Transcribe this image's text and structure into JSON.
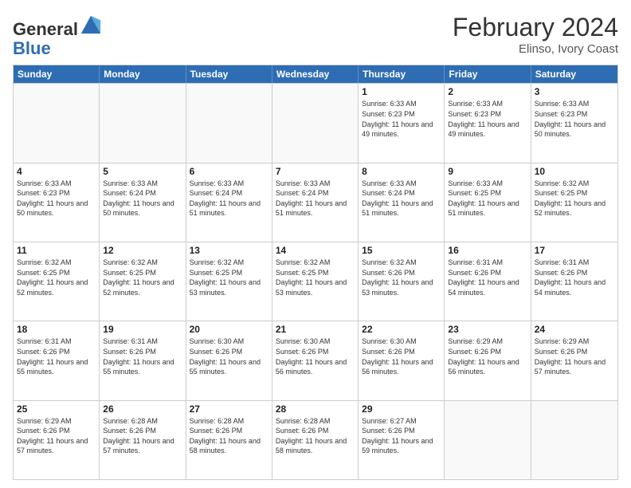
{
  "header": {
    "logo_line1": "General",
    "logo_line2": "Blue",
    "title": "February 2024",
    "subtitle": "Elinso, Ivory Coast"
  },
  "days_of_week": [
    "Sunday",
    "Monday",
    "Tuesday",
    "Wednesday",
    "Thursday",
    "Friday",
    "Saturday"
  ],
  "weeks": [
    [
      {
        "day": "",
        "info": "",
        "empty": true
      },
      {
        "day": "",
        "info": "",
        "empty": true
      },
      {
        "day": "",
        "info": "",
        "empty": true
      },
      {
        "day": "",
        "info": "",
        "empty": true
      },
      {
        "day": "1",
        "info": "Sunrise: 6:33 AM\nSunset: 6:23 PM\nDaylight: 11 hours\nand 49 minutes."
      },
      {
        "day": "2",
        "info": "Sunrise: 6:33 AM\nSunset: 6:23 PM\nDaylight: 11 hours\nand 49 minutes."
      },
      {
        "day": "3",
        "info": "Sunrise: 6:33 AM\nSunset: 6:23 PM\nDaylight: 11 hours\nand 50 minutes."
      }
    ],
    [
      {
        "day": "4",
        "info": "Sunrise: 6:33 AM\nSunset: 6:23 PM\nDaylight: 11 hours\nand 50 minutes."
      },
      {
        "day": "5",
        "info": "Sunrise: 6:33 AM\nSunset: 6:24 PM\nDaylight: 11 hours\nand 50 minutes."
      },
      {
        "day": "6",
        "info": "Sunrise: 6:33 AM\nSunset: 6:24 PM\nDaylight: 11 hours\nand 51 minutes."
      },
      {
        "day": "7",
        "info": "Sunrise: 6:33 AM\nSunset: 6:24 PM\nDaylight: 11 hours\nand 51 minutes."
      },
      {
        "day": "8",
        "info": "Sunrise: 6:33 AM\nSunset: 6:24 PM\nDaylight: 11 hours\nand 51 minutes."
      },
      {
        "day": "9",
        "info": "Sunrise: 6:33 AM\nSunset: 6:25 PM\nDaylight: 11 hours\nand 51 minutes."
      },
      {
        "day": "10",
        "info": "Sunrise: 6:32 AM\nSunset: 6:25 PM\nDaylight: 11 hours\nand 52 minutes."
      }
    ],
    [
      {
        "day": "11",
        "info": "Sunrise: 6:32 AM\nSunset: 6:25 PM\nDaylight: 11 hours\nand 52 minutes."
      },
      {
        "day": "12",
        "info": "Sunrise: 6:32 AM\nSunset: 6:25 PM\nDaylight: 11 hours\nand 52 minutes."
      },
      {
        "day": "13",
        "info": "Sunrise: 6:32 AM\nSunset: 6:25 PM\nDaylight: 11 hours\nand 53 minutes."
      },
      {
        "day": "14",
        "info": "Sunrise: 6:32 AM\nSunset: 6:25 PM\nDaylight: 11 hours\nand 53 minutes."
      },
      {
        "day": "15",
        "info": "Sunrise: 6:32 AM\nSunset: 6:26 PM\nDaylight: 11 hours\nand 53 minutes."
      },
      {
        "day": "16",
        "info": "Sunrise: 6:31 AM\nSunset: 6:26 PM\nDaylight: 11 hours\nand 54 minutes."
      },
      {
        "day": "17",
        "info": "Sunrise: 6:31 AM\nSunset: 6:26 PM\nDaylight: 11 hours\nand 54 minutes."
      }
    ],
    [
      {
        "day": "18",
        "info": "Sunrise: 6:31 AM\nSunset: 6:26 PM\nDaylight: 11 hours\nand 55 minutes."
      },
      {
        "day": "19",
        "info": "Sunrise: 6:31 AM\nSunset: 6:26 PM\nDaylight: 11 hours\nand 55 minutes."
      },
      {
        "day": "20",
        "info": "Sunrise: 6:30 AM\nSunset: 6:26 PM\nDaylight: 11 hours\nand 55 minutes."
      },
      {
        "day": "21",
        "info": "Sunrise: 6:30 AM\nSunset: 6:26 PM\nDaylight: 11 hours\nand 56 minutes."
      },
      {
        "day": "22",
        "info": "Sunrise: 6:30 AM\nSunset: 6:26 PM\nDaylight: 11 hours\nand 56 minutes."
      },
      {
        "day": "23",
        "info": "Sunrise: 6:29 AM\nSunset: 6:26 PM\nDaylight: 11 hours\nand 56 minutes."
      },
      {
        "day": "24",
        "info": "Sunrise: 6:29 AM\nSunset: 6:26 PM\nDaylight: 11 hours\nand 57 minutes."
      }
    ],
    [
      {
        "day": "25",
        "info": "Sunrise: 6:29 AM\nSunset: 6:26 PM\nDaylight: 11 hours\nand 57 minutes."
      },
      {
        "day": "26",
        "info": "Sunrise: 6:28 AM\nSunset: 6:26 PM\nDaylight: 11 hours\nand 57 minutes."
      },
      {
        "day": "27",
        "info": "Sunrise: 6:28 AM\nSunset: 6:26 PM\nDaylight: 11 hours\nand 58 minutes."
      },
      {
        "day": "28",
        "info": "Sunrise: 6:28 AM\nSunset: 6:26 PM\nDaylight: 11 hours\nand 58 minutes."
      },
      {
        "day": "29",
        "info": "Sunrise: 6:27 AM\nSunset: 6:26 PM\nDaylight: 11 hours\nand 59 minutes."
      },
      {
        "day": "",
        "info": "",
        "empty": true
      },
      {
        "day": "",
        "info": "",
        "empty": true
      }
    ]
  ]
}
